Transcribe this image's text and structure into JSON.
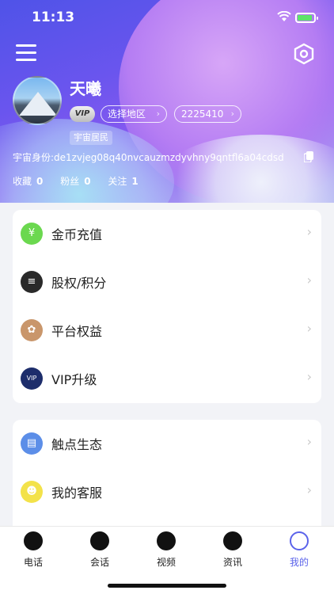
{
  "status_bar": {
    "time": "11:13"
  },
  "profile": {
    "name": "天曦",
    "vip_badge": "VIP",
    "region_label": "选择地区",
    "user_id": "2225410",
    "resident_tag": "宇宙居民",
    "identity": "宇宙身份:de1zvjeg08q40nvcauzmzdyvhny9qntfl6a04cdsd"
  },
  "stats": [
    {
      "label": "收藏",
      "value": "0"
    },
    {
      "label": "粉丝",
      "value": "0"
    },
    {
      "label": "关注",
      "value": "1"
    }
  ],
  "menu_card1": [
    {
      "label": "金币充值",
      "icon": "coin-icon",
      "color": "#6bd84f"
    },
    {
      "label": "股权/积分",
      "icon": "database-icon",
      "color": "#2a2a2a"
    },
    {
      "label": "平台权益",
      "icon": "certificate-icon",
      "color": "#c9966b"
    },
    {
      "label": "VIP升级",
      "icon": "vip-icon",
      "color": "#1d2d6b"
    }
  ],
  "menu_card2": [
    {
      "label": "触点生态",
      "icon": "store-icon",
      "color": "#5c8ee8"
    },
    {
      "label": "我的客服",
      "icon": "support-icon",
      "color": "#f3e24a"
    }
  ],
  "tabs": [
    {
      "label": "电话",
      "icon": "phone-icon"
    },
    {
      "label": "会话",
      "icon": "chat-icon"
    },
    {
      "label": "视频",
      "icon": "video-icon"
    },
    {
      "label": "资讯",
      "icon": "news-icon"
    },
    {
      "label": "我的",
      "icon": "profile-icon",
      "active": true
    }
  ],
  "colors": {
    "accent": "#5b63ea"
  }
}
